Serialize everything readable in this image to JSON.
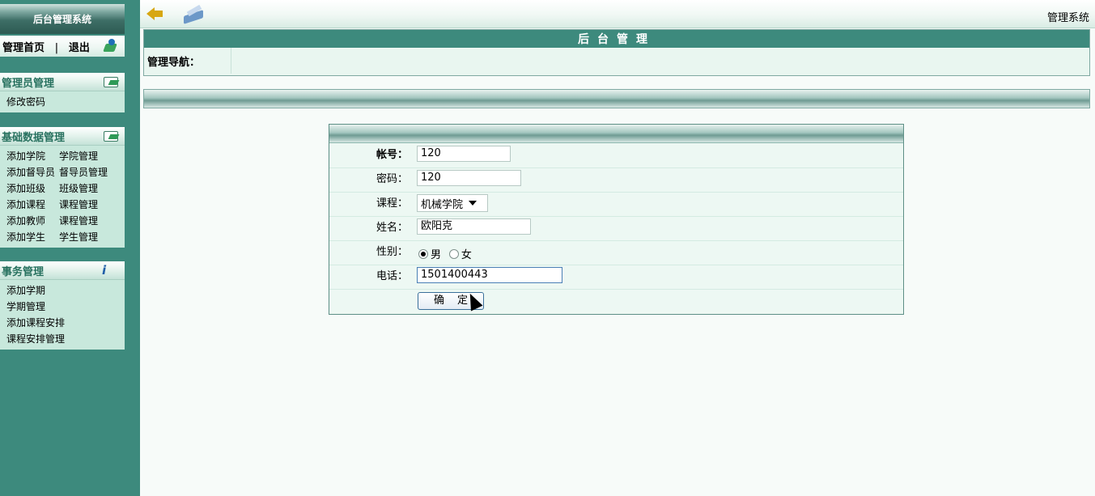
{
  "sidebar": {
    "brand": "后台管理系统",
    "home": {
      "home_label": "管理首页",
      "separator": "|",
      "logout_label": "退出"
    },
    "admin_panel": {
      "title": "管理员管理",
      "items": [
        "修改密码"
      ]
    },
    "data_panel": {
      "title": "基础数据管理",
      "rows": [
        [
          "添加学院",
          "学院管理"
        ],
        [
          "添加督导员",
          "督导员管理"
        ],
        [
          "添加班级",
          "班级管理"
        ],
        [
          "添加课程",
          "课程管理"
        ],
        [
          "添加教师",
          "课程管理"
        ],
        [
          "添加学生",
          "学生管理"
        ]
      ]
    },
    "affairs_panel": {
      "title": "事务管理",
      "items": [
        "添加学期",
        "学期管理",
        "添加课程安排",
        "课程安排管理"
      ]
    }
  },
  "topbar": {
    "system_title": "管理系统"
  },
  "main": {
    "header": "后台管理",
    "nav_label": "管理导航："
  },
  "form": {
    "account": {
      "label": "帐号：",
      "value": "120"
    },
    "password": {
      "label": "密码：",
      "value": "120"
    },
    "course": {
      "label": "课程：",
      "value": "机械学院"
    },
    "name": {
      "label": "姓名：",
      "value": "欧阳克"
    },
    "gender": {
      "label": "性别：",
      "options": [
        "男",
        "女"
      ],
      "selected": "男"
    },
    "phone": {
      "label": "电话：",
      "value": "1501400443"
    },
    "submit_label": "确定"
  },
  "colors": {
    "sidebar_bg": "#3d8a7d",
    "header_bg": "#3d8a7d",
    "panel_bg": "#c8e8dc"
  }
}
